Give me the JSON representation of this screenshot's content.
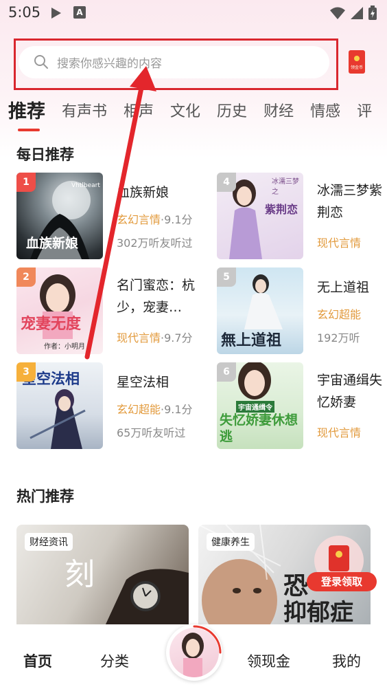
{
  "status_bar": {
    "time": "5:05",
    "app_badge": "A"
  },
  "search": {
    "placeholder": "搜索你感兴趣的内容",
    "redpacket_label": "领金币"
  },
  "tabs": [
    {
      "label": "推荐"
    },
    {
      "label": "有声书"
    },
    {
      "label": "相声"
    },
    {
      "label": "文化"
    },
    {
      "label": "历史"
    },
    {
      "label": "财经"
    },
    {
      "label": "情感"
    },
    {
      "label": "评"
    }
  ],
  "daily": {
    "title": "每日推荐",
    "books": [
      {
        "rank": "1",
        "title": "血族新娘",
        "genre": "玄幻言情",
        "score": "·9.1分",
        "listens": "302万听友听过",
        "cover_text": "血族新娘",
        "cover_sub": "Vhtlbeart"
      },
      {
        "rank": "2",
        "title": "名门蜜恋：杭少，宠妻…",
        "genre": "现代言情",
        "score": "·9.7分",
        "listens": "",
        "cover_text": "宠妻无度",
        "cover_sub": "作者：小明月"
      },
      {
        "rank": "3",
        "title": "星空法相",
        "genre": "玄幻超能",
        "score": "·9.1分",
        "listens": "65万听友听过",
        "cover_text": "星空法相",
        "cover_sub": ""
      },
      {
        "rank": "4",
        "title": "冰濡三梦紫荆恋",
        "genre": "现代言情",
        "score": "",
        "listens": "",
        "cover_text": "紫荆恋",
        "cover_sub": "冰濡三梦之"
      },
      {
        "rank": "5",
        "title": "无上道祖",
        "genre": "玄幻超能",
        "score": "",
        "listens": "192万听",
        "cover_text": "無上道祖",
        "cover_sub": ""
      },
      {
        "rank": "6",
        "title": "宇宙通缉失忆娇妻",
        "genre": "现代言情",
        "score": "",
        "listens": "",
        "cover_text": "失忆娇妻休想逃",
        "cover_sub": "宇宙通缉令"
      }
    ]
  },
  "hot": {
    "title": "热门推荐",
    "cards": [
      {
        "tag": "财经资讯",
        "overlay_text": "刻"
      },
      {
        "tag": "健康养生",
        "overlay_text": "恐",
        "overlay_text2": "抑郁症"
      }
    ]
  },
  "float_ad": {
    "button_label": "登录领取"
  },
  "bottom_nav": [
    {
      "label": "首页"
    },
    {
      "label": "分类"
    },
    {
      "label": "领现金"
    },
    {
      "label": "我的"
    }
  ],
  "colors": {
    "accent": "#e8392f",
    "genre": "#e29a3c",
    "highlight_box": "#d9272e"
  }
}
